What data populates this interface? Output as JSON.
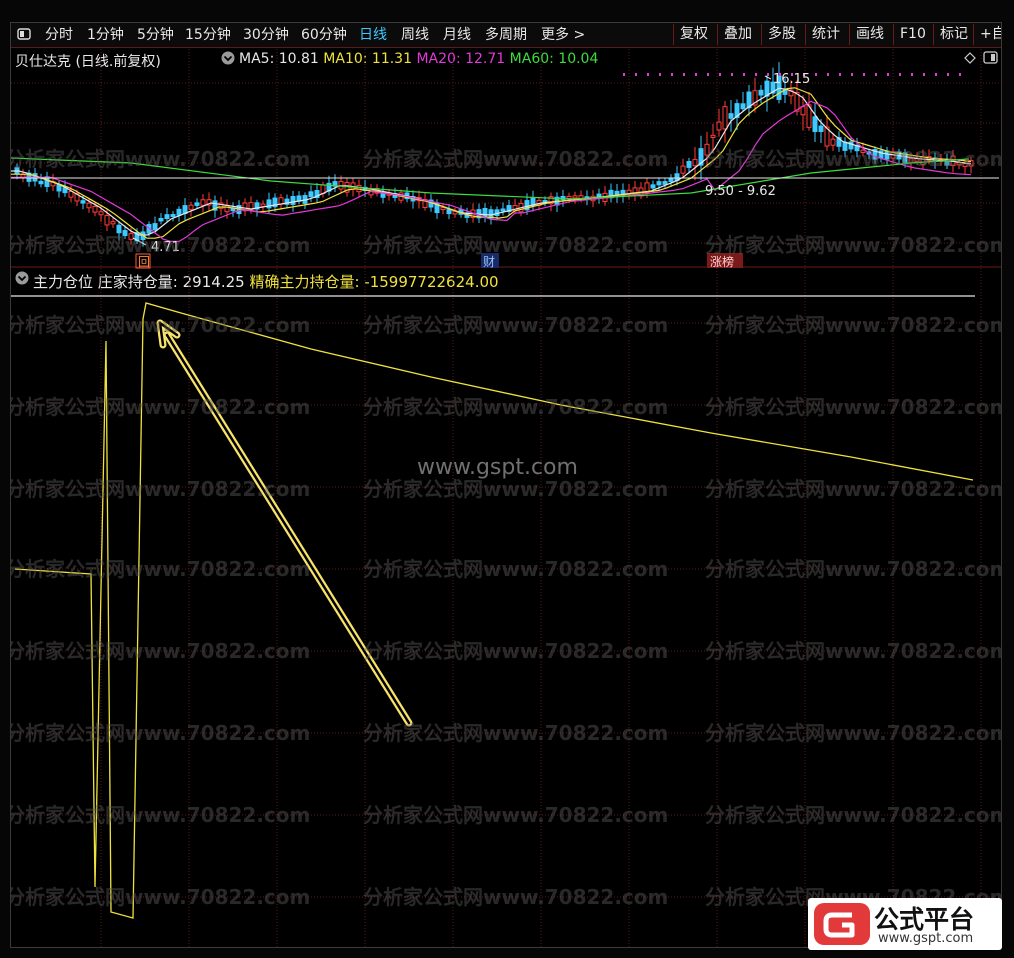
{
  "toolbar": {
    "left": [
      "分时",
      "1分钟",
      "5分钟",
      "15分钟",
      "30分钟",
      "60分钟",
      "日线",
      "周线",
      "月线",
      "多周期",
      "更多 >"
    ],
    "active_index": 6,
    "right": [
      "复权",
      "叠加",
      "多股",
      "统计",
      "画线",
      "F10",
      "标记",
      "+自"
    ]
  },
  "price_panel": {
    "title": "贝仕达克 (日线.前复权)",
    "ma": [
      {
        "label": "MA5:",
        "value": "10.81",
        "color": "#e8e8e8"
      },
      {
        "label": "MA10:",
        "value": "11.31",
        "color": "#f0e23c"
      },
      {
        "label": "MA20:",
        "value": "12.71",
        "color": "#e03ad8"
      },
      {
        "label": "MA60:",
        "value": "10.04",
        "color": "#3ddc3d"
      }
    ],
    "high_label": "16.15",
    "low_label": "4.71",
    "range_label": "9.50 - 9.62",
    "marker_hui": "回",
    "marker_cai": "财",
    "marker_zhangbang": "涨榜"
  },
  "indicator_panel": {
    "name": "主力仓位",
    "items": [
      {
        "label": "庄家持仓量:",
        "value": "2914.25",
        "color": "#e8e8e8"
      },
      {
        "label": "精确主力持仓量:",
        "value": "-15997722624.00",
        "color": "#f0e23c"
      }
    ]
  },
  "watermark_site": "www.gspt.com",
  "watermark_repeat": "分析家公式网www.70822.com",
  "logo": {
    "text": "公式平台",
    "url": "www.gspt.com"
  },
  "colors": {
    "up": "#ff3c3c",
    "down": "#3ec9ff",
    "ma5": "#e8e8e8",
    "ma10": "#f0e23c",
    "ma20": "#e03ad8",
    "ma60": "#3ddc3d",
    "indicator": "#f0e23c",
    "grid": "#5a1a1a"
  },
  "chart_data": [
    {
      "type": "line",
      "series": [
        {
          "name": "MA5",
          "values": []
        },
        {
          "name": "MA10",
          "values": []
        },
        {
          "name": "MA20",
          "values": []
        },
        {
          "name": "MA60",
          "values": []
        }
      ],
      "annotations": [
        "16.15",
        "4.71",
        "9.50 - 9.62"
      ]
    },
    {
      "type": "line",
      "series": [
        {
          "name": "精确主力持仓量",
          "values": []
        }
      ]
    }
  ]
}
